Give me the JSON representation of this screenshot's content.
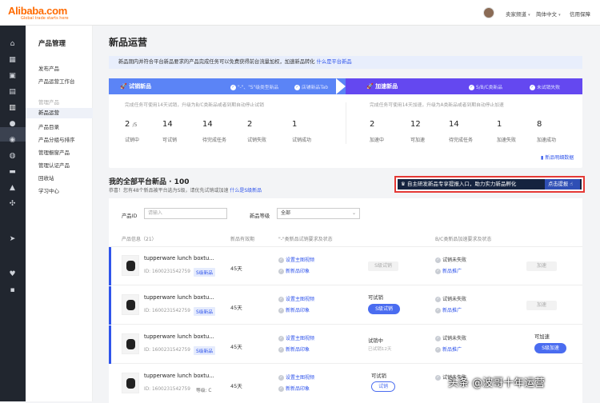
{
  "header": {
    "logo": "Alibaba.com",
    "tagline": "Global trade starts here",
    "menu": [
      "卖家频道",
      "简体中文",
      "信用保障"
    ]
  },
  "nav_icons": [
    "home-icon",
    "grid-icon",
    "apps-icon",
    "file-icon",
    "chart-icon",
    "user-icon",
    "group-icon",
    "globe-icon",
    "truck-icon",
    "bank-icon",
    "share-icon",
    "send-icon",
    "heart-icon",
    "briefcase-icon"
  ],
  "sidemenu": {
    "title": "产品管理",
    "items": [
      "发布产品",
      "产品运营工作台"
    ],
    "group_label": "管理产品",
    "group_items": [
      "新品运营",
      "产品目录",
      "产品分组与排序",
      "管理橱窗产品",
      "管理认证产品",
      "回收站",
      "学习中心"
    ]
  },
  "page": {
    "title": "新品运营",
    "notice": "新品期内并符合平台新品要求的产品完成任务可以免费获得前台流量加权，加速新品转化",
    "notice_link": "什么是平台新品"
  },
  "panel": {
    "left": {
      "title": "试销新品",
      "tags": [
        "\"-\"、\"S\"级类型新品",
        "店铺新品Tab"
      ],
      "desc": "完成任务可使用14天试销，升级为B/C类新品或者到期自动停止试销",
      "stats": [
        {
          "num": "2",
          "suffix": "/5",
          "label": "试销中"
        },
        {
          "num": "14",
          "label": "可试销"
        },
        {
          "num": "14",
          "label": "待完成任务"
        },
        {
          "num": "2",
          "label": "试销失败"
        },
        {
          "num": "1",
          "label": "试销成功"
        }
      ]
    },
    "right": {
      "title": "加速新品",
      "tags": [
        "S/B/C类新品",
        "未试销失败"
      ],
      "desc": "完成任务可使用14天加速，升级为A类新品或者到期自动停止加速",
      "stats": [
        {
          "num": "2",
          "label": "加速中"
        },
        {
          "num": "12",
          "label": "可加速"
        },
        {
          "num": "14",
          "label": "待完成任务"
        },
        {
          "num": "1",
          "label": "加速失败"
        },
        {
          "num": "8",
          "label": "加速成功"
        }
      ]
    },
    "link": "新品明细数据"
  },
  "list": {
    "title": "我的全部平台新品 · 100",
    "subtitle": "恭喜！您有48个新品被平台选为S级，请优先试销或加速",
    "subtitle_link": "什么是S级新品",
    "promo_text": "自主研发新品专享提报入口，助力实力新品孵化",
    "promo_button": "点击提报"
  },
  "filters": {
    "id_label": "产品ID",
    "id_placeholder": "请输入",
    "level_label": "新品等级",
    "level_value": "全部"
  },
  "columns": [
    "产品信息（21）",
    "新品有效期",
    "\"-\"类新品试销要求及状态",
    "B/C类新品加速要求及状态"
  ],
  "rows": [
    {
      "name": "tupperware lunch boxtu...",
      "id": "ID: 1600231542759",
      "badge": "S级新品",
      "days": "45天",
      "tasks": [
        "设置主图视频",
        "新新品印象"
      ],
      "trial_status": "",
      "trial_button": "S级试销",
      "trial_btn_style": "grey",
      "accel_tasks": [
        "试销未失败",
        "新品推广"
      ],
      "accel_status": "",
      "accel_button": "加速",
      "accel_btn_style": "grey"
    },
    {
      "name": "tupperware lunch boxtu...",
      "id": "ID: 1600231542759",
      "badge": "S级新品",
      "days": "45天",
      "tasks": [
        "设置主图视频",
        "新新品印象"
      ],
      "trial_status": "可试销",
      "trial_button": "S级试销",
      "trial_btn_style": "blue",
      "accel_tasks": [
        "试销未失败",
        "新品推广"
      ],
      "accel_status": "",
      "accel_button": "加速",
      "accel_btn_style": "grey"
    },
    {
      "name": "tupperware lunch boxtu...",
      "id": "ID: 1600231542759",
      "badge": "S级新品",
      "days": "45天",
      "tasks": [
        "设置主图视频",
        "新新品印象"
      ],
      "trial_status": "试销中",
      "trial_sub": "已试销12天",
      "trial_button": "",
      "accel_tasks": [
        "试销未失败",
        "新品推广"
      ],
      "accel_status": "可加速",
      "accel_button": "S级加速",
      "accel_btn_style": "blue"
    },
    {
      "name": "tupperware lunch boxtu...",
      "id": "ID: 1600231542759",
      "badge": "等级: C",
      "days": "45天",
      "tasks": [
        "设置主图视频",
        "新新品印象"
      ],
      "trial_status": "可试销",
      "trial_button": "试销",
      "trial_btn_style": "outline",
      "accel_tasks": [
        "试销未失败"
      ],
      "accel_status": "",
      "accel_button": "",
      "accel_btn_style": ""
    }
  ],
  "watermark": "头条 @波哥十年运营"
}
